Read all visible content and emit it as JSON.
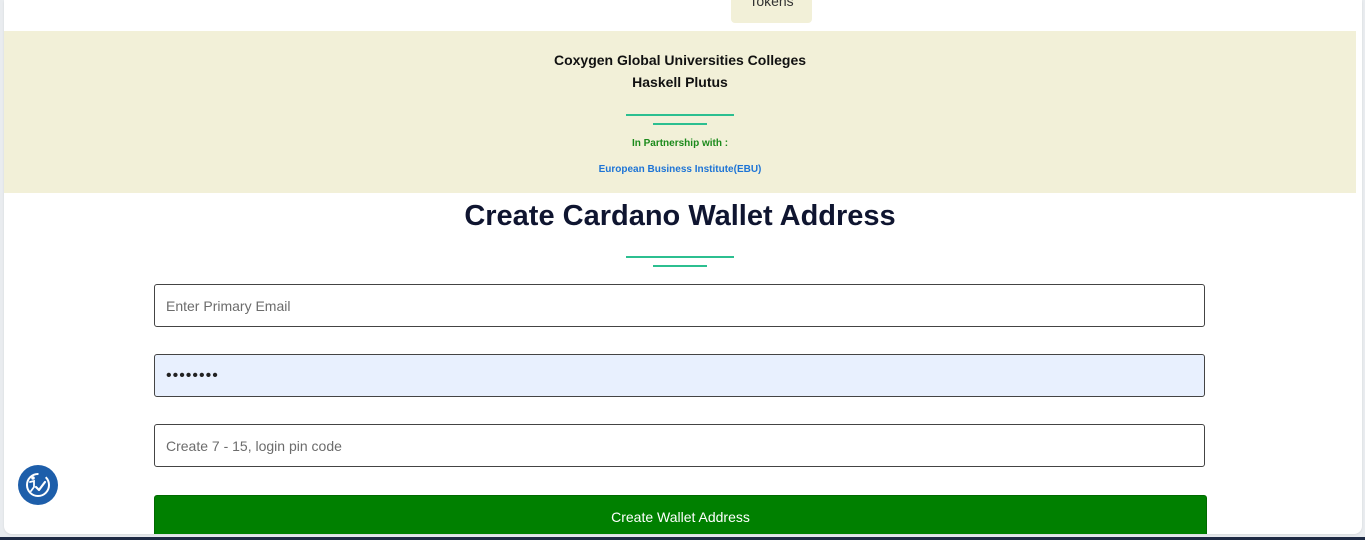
{
  "header": {
    "tokens_tab_label": "Tokens"
  },
  "banner": {
    "title_line1": "Coxygen Global Universities Colleges",
    "title_line2": "Haskell Plutus",
    "partnership_label": "In Partnership with :",
    "partner_name": "European Business Institute(EBU)"
  },
  "form": {
    "heading": "Create Cardano Wallet Address",
    "email_placeholder": "Enter Primary Email",
    "email_value": "",
    "password_value": "12345678",
    "pin_placeholder": "Create 7 - 15, login pin code",
    "pin_value": "",
    "submit_label": "Create Wallet Address"
  },
  "accessibility": {
    "icon": "accessibility-icon"
  },
  "colors": {
    "banner_bg": "#f2f0d8",
    "accent_divider": "#2cbf90",
    "partnership_text": "#1b8a1b",
    "partner_link": "#1d74d6",
    "submit_bg": "#008000",
    "password_autofill_bg": "#e8f0fe",
    "accessibility_bg": "#1d5eaa"
  }
}
